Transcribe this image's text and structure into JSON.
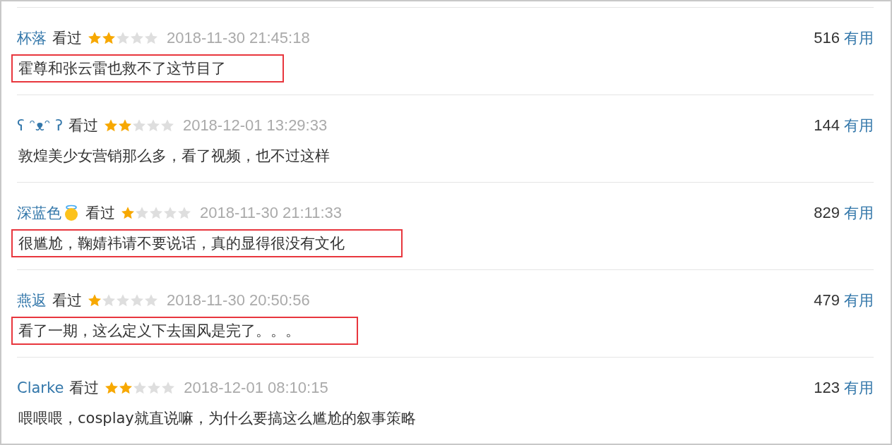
{
  "comments": [
    {
      "user": "杯落",
      "status": "看过",
      "stars": 2,
      "time": "2018-11-30 21:45:18",
      "votes": "516",
      "useful": "有用",
      "text": "霍尊和张云雷也救不了这节目了",
      "badge_icon": false,
      "highlighted": true
    },
    {
      "user": "ʕ ᵔᴥᵔ ʔ",
      "status": "看过",
      "stars": 2,
      "time": "2018-12-01 13:29:33",
      "votes": "144",
      "useful": "有用",
      "text": "敦煌美少女营销那么多，看了视频，也不过这样",
      "badge_icon": false,
      "highlighted": false
    },
    {
      "user": "深蓝色",
      "status": "看过",
      "stars": 1,
      "time": "2018-11-30 21:11:33",
      "votes": "829",
      "useful": "有用",
      "text": "很尴尬，鞠婧祎请不要说话，真的显得很没有文化",
      "badge_icon": true,
      "highlighted": true
    },
    {
      "user": "燕返",
      "status": "看过",
      "stars": 1,
      "time": "2018-11-30 20:50:56",
      "votes": "479",
      "useful": "有用",
      "text": "看了一期，这么定义下去国风是完了。。。",
      "badge_icon": false,
      "highlighted": true
    },
    {
      "user": "Clarke",
      "status": "看过",
      "stars": 2,
      "time": "2018-12-01 08:10:15",
      "votes": "123",
      "useful": "有用",
      "text": "喂喂喂，cosplay就直说嘛，为什么要搞这么尴尬的叙事策略",
      "badge_icon": false,
      "highlighted": false
    }
  ]
}
